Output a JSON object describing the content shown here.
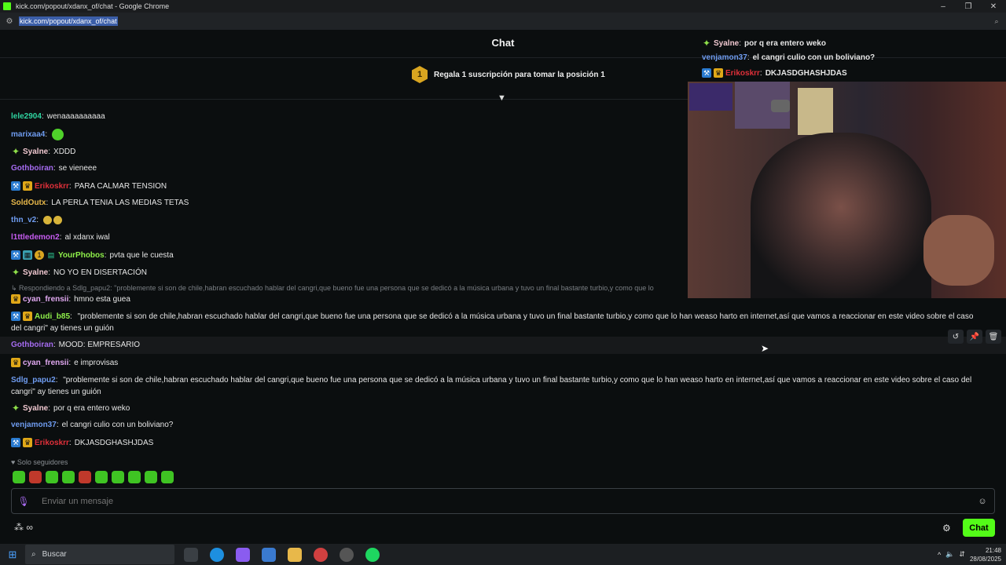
{
  "window": {
    "title": "kick.com/popout/xdanx_of/chat - Google Chrome",
    "url": "kick.com/popout/xdanx_of/chat"
  },
  "header": {
    "title": "Chat"
  },
  "promo": {
    "rank": "1",
    "text": "Regala 1 suscripción para tomar la posición 1"
  },
  "colors": {
    "accent": "#53fc18",
    "vip": "#2a7bd0",
    "crown": "#e0a818"
  },
  "messages": [
    {
      "user": "lele2904",
      "color": "#2fd4a0",
      "badges": [],
      "text": "wenaaaaaaaaaa"
    },
    {
      "user": "marixaa4",
      "color": "#6f9cf0",
      "badges": [],
      "text": "",
      "emote": "kick-emote"
    },
    {
      "user": "Syalne",
      "color": "#f0c8d0",
      "badges": [
        "star"
      ],
      "text": "XDDD"
    },
    {
      "user": "Gothboiran",
      "color": "#a56bf0",
      "badges": [],
      "text": "se vieneee"
    },
    {
      "user": "Erikoskrr",
      "color": "#e0303a",
      "badges": [
        "vip",
        "crown"
      ],
      "text": "PARA CALMAR TENSION"
    },
    {
      "user": "SoldOutx",
      "color": "#e8b84a",
      "badges": [],
      "text": "LA PERLA TENIA LAS MEDIAS TETAS"
    },
    {
      "user": "thn_v2",
      "color": "#6f9cf0",
      "badges": [],
      "text": "",
      "emote": "smile-emote"
    },
    {
      "user": "l1ttledemon2",
      "color": "#c65cf0",
      "badges": [],
      "text": "al xdanx iwal"
    },
    {
      "user": "YourPhobos",
      "color": "#8ff04a",
      "badges": [
        "vip",
        "grid",
        "one",
        "gift"
      ],
      "text": "pvta que le cuesta"
    },
    {
      "user": "Syalne",
      "color": "#f0c8d0",
      "badges": [
        "star"
      ],
      "text": "NO YO EN DISERTACIÓN"
    }
  ],
  "reply_context": "Respondiendo a Sdlg_papu2: \"problemente si son de chile,habran escuchado hablar del cangri,que bueno fue una persona que se dedicó a la música urbana y tuvo un final bastante turbio,y como que lo",
  "messages2": [
    {
      "user": "cyan_frensii",
      "color": "#e0a8f0",
      "badges": [
        "crown"
      ],
      "text": "hmno esta guea"
    },
    {
      "user": "Audi_b85",
      "color": "#8ff04a",
      "badges": [
        "vip",
        "crown"
      ],
      "text": "\"problemente si son de chile,habran escuchado hablar del cangri,que bueno fue una persona que se dedicó a la música urbana y tuvo un final bastante turbio,y como que lo han weaso harto en internet,así que vamos a reaccionar en este video sobre el caso del cangri\" ay tienes un guión"
    },
    {
      "user": "Gothboiran",
      "color": "#a56bf0",
      "badges": [],
      "text": "MOOD: EMPRESARIO"
    },
    {
      "user": "cyan_frensii",
      "color": "#e0a8f0",
      "badges": [
        "crown"
      ],
      "text": "e improvisas"
    },
    {
      "user": "Sdlg_papu2",
      "color": "#6f9cf0",
      "badges": [],
      "text": "\"problemente si son de chile,habran escuchado hablar del cangri,que bueno fue una persona que se dedicó a la música urbana y tuvo un final bastante turbio,y como que lo han weaso harto en internet,así que vamos a reaccionar en este video sobre el caso del cangri\" ay tienes un guión"
    },
    {
      "user": "Syalne",
      "color": "#f0c8d0",
      "badges": [
        "star"
      ],
      "text": "por q era entero weko"
    },
    {
      "user": "venjamon37",
      "color": "#6f9cf0",
      "badges": [],
      "text": "el cangri culio con un boliviano?"
    },
    {
      "user": "Erikoskrr",
      "color": "#e0303a",
      "badges": [
        "vip",
        "crown"
      ],
      "text": "DKJASDGHASHJDAS"
    }
  ],
  "overlay": [
    {
      "user": "Syalne",
      "text": "por q era entero weko"
    },
    {
      "user": "venjamon37",
      "text": "el cangri culio con un boliviano?"
    },
    {
      "user": "Erikoskrr",
      "text": "DKJASDGHASHJDAS"
    }
  ],
  "footer": {
    "followers_only": "Solo seguidores",
    "input_placeholder": "Enviar un mensaje",
    "points": "∞",
    "chat_button": "Chat"
  },
  "taskbar": {
    "search_placeholder": "Buscar",
    "time": "21:48",
    "date": "28/08/2025"
  }
}
